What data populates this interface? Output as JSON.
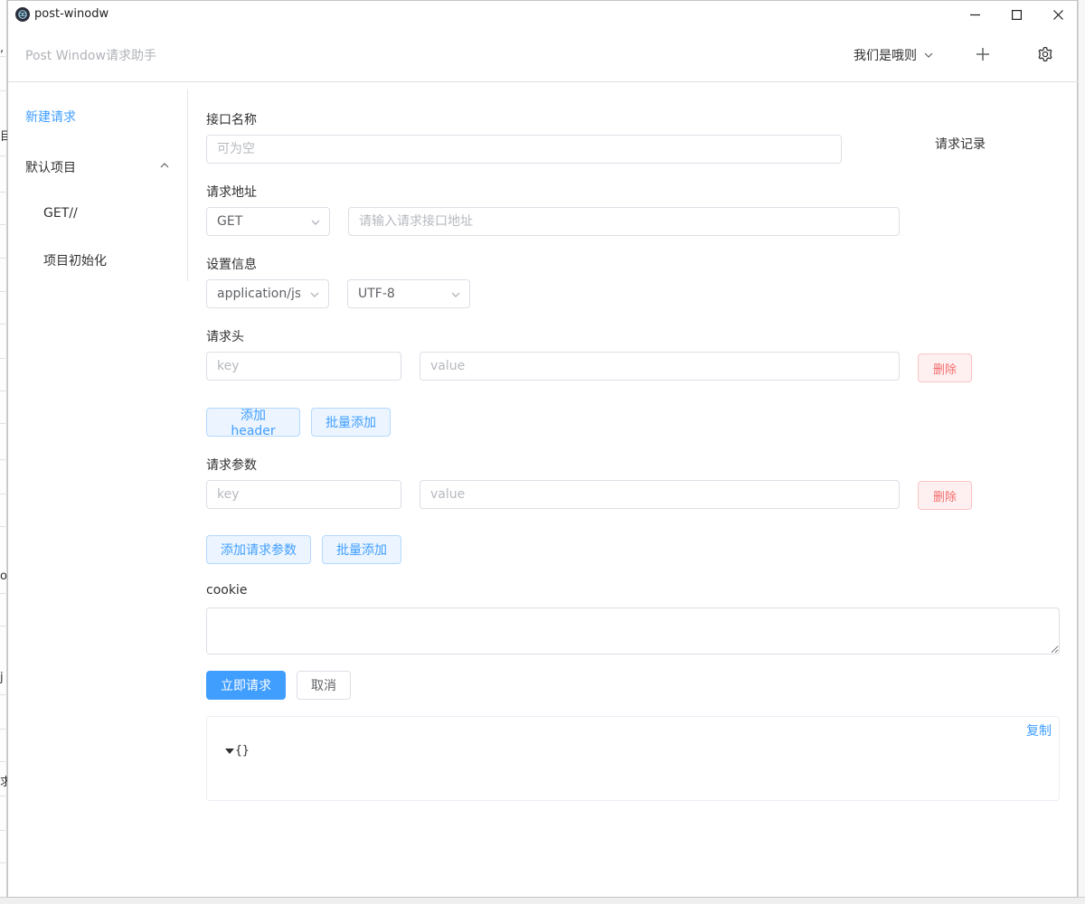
{
  "window": {
    "title": "post-winodw"
  },
  "header": {
    "brand": "Post Window请求助手",
    "user_name": "我们是哦则"
  },
  "sidebar": {
    "new_request": "新建请求",
    "group_label": "默认项目",
    "items": [
      {
        "label": "GET//"
      },
      {
        "label": "项目初始化"
      }
    ]
  },
  "form": {
    "name_label": "接口名称",
    "name_placeholder": "可为空",
    "url_label": "请求地址",
    "method_value": "GET",
    "url_placeholder": "请输入请求接口地址",
    "settings_label": "设置信息",
    "content_type_value": "application/json",
    "charset_value": "UTF-8",
    "headers_label": "请求头",
    "header_key_placeholder": "key",
    "header_value_placeholder": "value",
    "delete_label": "删除",
    "add_header_label": "添加header",
    "batch_add_label": "批量添加",
    "params_label": "请求参数",
    "param_key_placeholder": "key",
    "param_value_placeholder": "value",
    "add_param_label": "添加请求参数",
    "cookie_label": "cookie",
    "submit_label": "立即请求",
    "cancel_label": "取消"
  },
  "result": {
    "copy_label": "复制",
    "json_text": "{}"
  },
  "history": {
    "title": "请求记录"
  }
}
